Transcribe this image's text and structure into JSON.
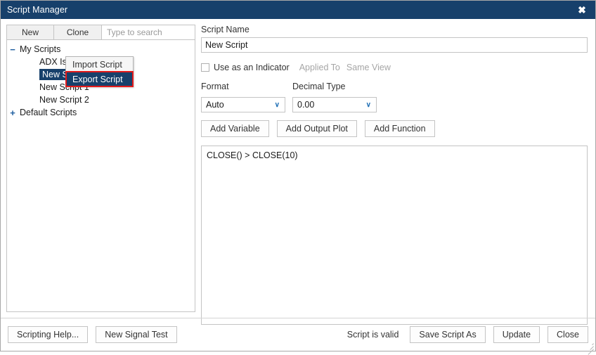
{
  "window": {
    "title": "Script Manager",
    "close_icon": "close-icon",
    "close_glyph": "✖"
  },
  "colors": {
    "titlebar_bg": "#17406b",
    "selection_bg": "#17406b",
    "highlight_outline": "#e31b1b",
    "chevron": "#1f6fb5",
    "tree_toggle": "#1f5fa0",
    "border": "#c4c4c4",
    "disabled_text": "#a6a6a6"
  },
  "toolbar": {
    "new_label": "New",
    "clone_label": "Clone",
    "search_placeholder": "Type to search",
    "search_value": ""
  },
  "context_menu": {
    "items": [
      {
        "label": "Import Script",
        "highlighted": false
      },
      {
        "label": "Export Script",
        "highlighted": true
      }
    ]
  },
  "tree": {
    "nodes": [
      {
        "label": "My Scripts",
        "toggle": "−",
        "level": 0,
        "selected": false
      },
      {
        "label": "ADX Is Ab",
        "toggle": "",
        "level": 1,
        "selected": false
      },
      {
        "label": "New Script",
        "toggle": "",
        "level": 1,
        "selected": true
      },
      {
        "label": "New Script 1",
        "toggle": "",
        "level": 1,
        "selected": false
      },
      {
        "label": "New Script 2",
        "toggle": "",
        "level": 1,
        "selected": false
      },
      {
        "label": "Default Scripts",
        "toggle": "+",
        "level": 0,
        "selected": false
      }
    ]
  },
  "form": {
    "script_name_label": "Script Name",
    "script_name_value": "New Script",
    "use_as_indicator_label": "Use as an Indicator",
    "use_as_indicator_checked": false,
    "applied_to_label": "Applied To",
    "same_view_label": "Same View",
    "format_label": "Format",
    "format_value": "Auto",
    "decimal_type_label": "Decimal Type",
    "decimal_type_value": "0.00",
    "chevron_glyph": "∨",
    "add_variable_label": "Add Variable",
    "add_output_plot_label": "Add Output Plot",
    "add_function_label": "Add Function"
  },
  "editor": {
    "code": "CLOSE() > CLOSE(10)"
  },
  "footer": {
    "scripting_help_label": "Scripting Help...",
    "new_signal_test_label": "New Signal Test",
    "status_text": "Script is valid",
    "save_script_as_label": "Save Script As",
    "update_label": "Update",
    "close_label": "Close"
  }
}
